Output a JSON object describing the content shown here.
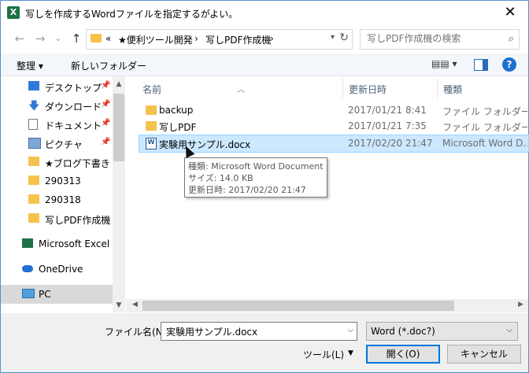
{
  "window": {
    "title": "写しを作成するWordファイルを指定するがよい。",
    "app_icon_letter": "X"
  },
  "nav": {
    "back": "←",
    "forward": "→",
    "recent": "⌄",
    "up": "↑",
    "breadcrumb": [
      "«",
      "★便利ツール開発",
      "›",
      "写しPDF作成機",
      "›"
    ],
    "search_placeholder": "写しPDF作成機の検索"
  },
  "toolbar": {
    "organize": "整理 ▾",
    "new_folder": "新しいフォルダー",
    "view": "▤▤ ▾",
    "help": "?"
  },
  "sidebar": {
    "items": [
      {
        "label": "デスクトップ",
        "pinned": true
      },
      {
        "label": "ダウンロード",
        "pinned": true
      },
      {
        "label": "ドキュメント",
        "pinned": true
      },
      {
        "label": "ピクチャ",
        "pinned": true
      },
      {
        "label": "★ブログ下書き",
        "pinned": false
      },
      {
        "label": "290313",
        "pinned": false
      },
      {
        "label": "290318",
        "pinned": false
      },
      {
        "label": "写しPDF作成機",
        "pinned": false
      },
      {
        "label": "Microsoft Excel",
        "pinned": false
      },
      {
        "label": "OneDrive",
        "pinned": false
      },
      {
        "label": "PC",
        "pinned": false
      }
    ]
  },
  "filelist": {
    "columns": {
      "name": "名前",
      "date": "更新日時",
      "type": "種類"
    },
    "rows": [
      {
        "name": "backup",
        "date": "2017/01/21 8:41",
        "type": "ファイル フォルダー"
      },
      {
        "name": "写しPDF",
        "date": "2017/01/21 7:35",
        "type": "ファイル フォルダー"
      },
      {
        "name": "実験用サンプル.docx",
        "date": "2017/02/20 21:47",
        "type": "Microsoft Word D..."
      }
    ]
  },
  "tooltip": {
    "line1": "種類: Microsoft Word Document",
    "line2": "サイズ: 14.0 KB",
    "line3": "更新日時: 2017/02/20 21:47"
  },
  "footer": {
    "filename_label": "ファイル名(N):",
    "filename_value": "実験用サンプル.docx",
    "filter_value": "Word (*.doc?)",
    "tools": "ツール(L)",
    "open": "開く(O)",
    "cancel": "キャンセル"
  },
  "colors": {
    "selection": "#cce8ff",
    "folder": "#f5c24d",
    "accent": "#0078d7"
  }
}
